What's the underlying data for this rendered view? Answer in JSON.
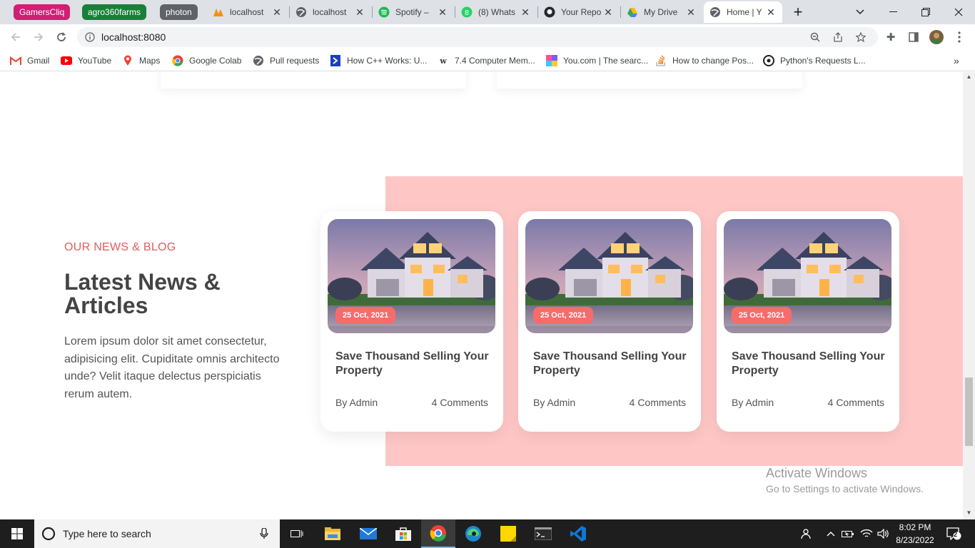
{
  "tab_groups": [
    {
      "label": "GamersCliq",
      "color": "#d01f74"
    },
    {
      "label": "agro360farms",
      "color": "#188038"
    },
    {
      "label": "photon",
      "color": "#5f6368"
    }
  ],
  "tabs": [
    {
      "label": "localhost",
      "icon": "pma-icon"
    },
    {
      "label": "localhost",
      "icon": "globe-icon"
    },
    {
      "label": "Spotify – ",
      "icon": "spotify-icon"
    },
    {
      "label": "(8) Whats",
      "icon": "whatsapp-icon"
    },
    {
      "label": "Your Repo",
      "icon": "github-icon"
    },
    {
      "label": "My Drive",
      "icon": "drive-icon"
    },
    {
      "label": "Home | Y",
      "icon": "globe-icon",
      "active": true
    }
  ],
  "toolbar": {
    "url": "localhost:8080"
  },
  "bookmarks": [
    {
      "label": "Gmail",
      "icon": "gmail-icon"
    },
    {
      "label": "YouTube",
      "icon": "youtube-icon"
    },
    {
      "label": "Maps",
      "icon": "maps-icon"
    },
    {
      "label": "Google Colab",
      "icon": "chrome-icon"
    },
    {
      "label": "Pull requests",
      "icon": "globe-icon"
    },
    {
      "label": "How C++ Works: U...",
      "icon": "bookmark-icon"
    },
    {
      "label": "7.4 Computer Mem...",
      "icon": "w-icon"
    },
    {
      "label": "You.com | The searc...",
      "icon": "youcom-icon"
    },
    {
      "label": "How to change Pos...",
      "icon": "stackoverflow-icon"
    },
    {
      "label": "Python's Requests L...",
      "icon": "python-icon"
    }
  ],
  "section": {
    "subtitle": "OUR NEWS & BLOG",
    "title": "Latest News & Articles",
    "lead": "Lorem ipsum dolor sit amet consectetur, adipisicing elit. Cupiditate omnis architecto unde? Velit itaque delectus perspiciatis rerum autem."
  },
  "cards": [
    {
      "date": "25 Oct, 2021",
      "title": "Save Thousand Selling Your Property",
      "author": "By Admin",
      "comments": "4 Comments"
    },
    {
      "date": "25 Oct, 2021",
      "title": "Save Thousand Selling Your Property",
      "author": "By Admin",
      "comments": "4 Comments"
    },
    {
      "date": "25 Oct, 2021",
      "title": "Save Thousand Selling Your Property",
      "author": "By Admin",
      "comments": "4 Comments"
    }
  ],
  "watermark": {
    "title": "Activate Windows",
    "text": "Go to Settings to activate Windows."
  },
  "taskbar": {
    "search_placeholder": "Type here to search",
    "time": "8:02 PM",
    "date": "8/23/2022",
    "notification_count": "2"
  },
  "colors": {
    "accent": "#e35b5b",
    "pink_band": "#fec7c6",
    "date_badge": "#f76b6b"
  }
}
